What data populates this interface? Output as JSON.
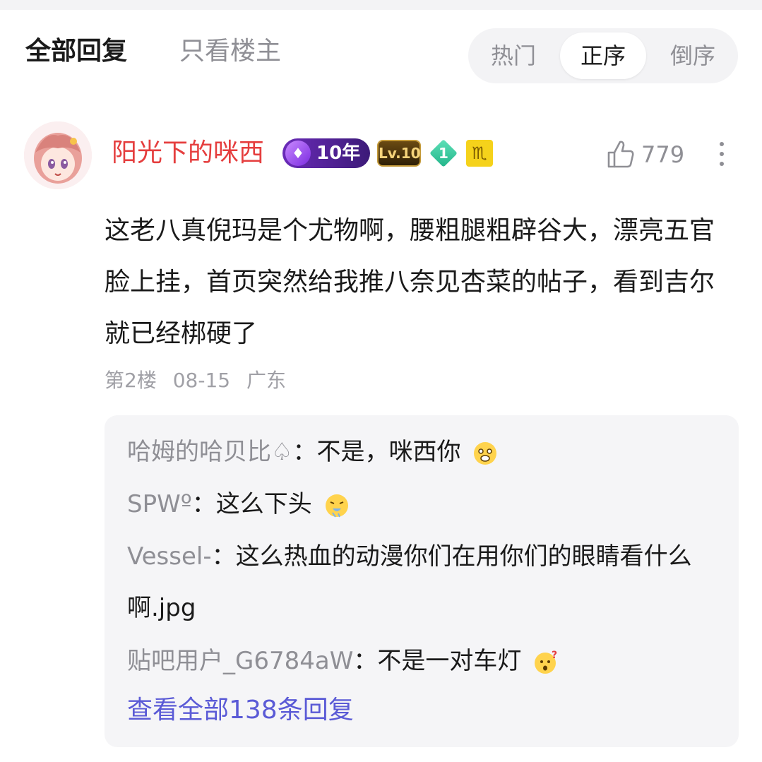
{
  "filters": {
    "all_replies": "全部回复",
    "owner_only": "只看楼主"
  },
  "sort": {
    "hot": "热门",
    "ascending": "正序",
    "descending": "倒序",
    "selected": "正序"
  },
  "post": {
    "author": "阳光下的咪西",
    "badges": {
      "years": "10年",
      "level": "Lv.10",
      "diamond": "1",
      "zodiac": "♏"
    },
    "likes": "779",
    "content": "这老八真倪玛是个尤物啊，腰粗腿粗辟谷大，漂亮五官脸上挂，首页突然给我推八奈见杏菜的帖子，看到吉尔就已经梆硬了",
    "floor": "第2楼",
    "date": "08-15",
    "location": "广东"
  },
  "replies": [
    {
      "author": "哈姆的哈贝比♤",
      "sep": "：",
      "text": "不是，咪西你",
      "emoji": "scared-face"
    },
    {
      "author": "SPWº",
      "sep": "：",
      "text": "这么下头",
      "emoji": "vomit-face"
    },
    {
      "author": "Vessel-",
      "sep": "：",
      "text": "这么热血的动漫你们在用你们的眼睛看什么啊.jpg",
      "emoji": ""
    },
    {
      "author": "贴吧用户_G6784aW",
      "sep": "：",
      "text": "不是一对车灯",
      "emoji": "confused-face"
    }
  ],
  "view_all": "查看全部138条回复",
  "colors": {
    "username": "#e53e3e",
    "link": "#5a5ad6",
    "muted": "#8f8f95"
  }
}
